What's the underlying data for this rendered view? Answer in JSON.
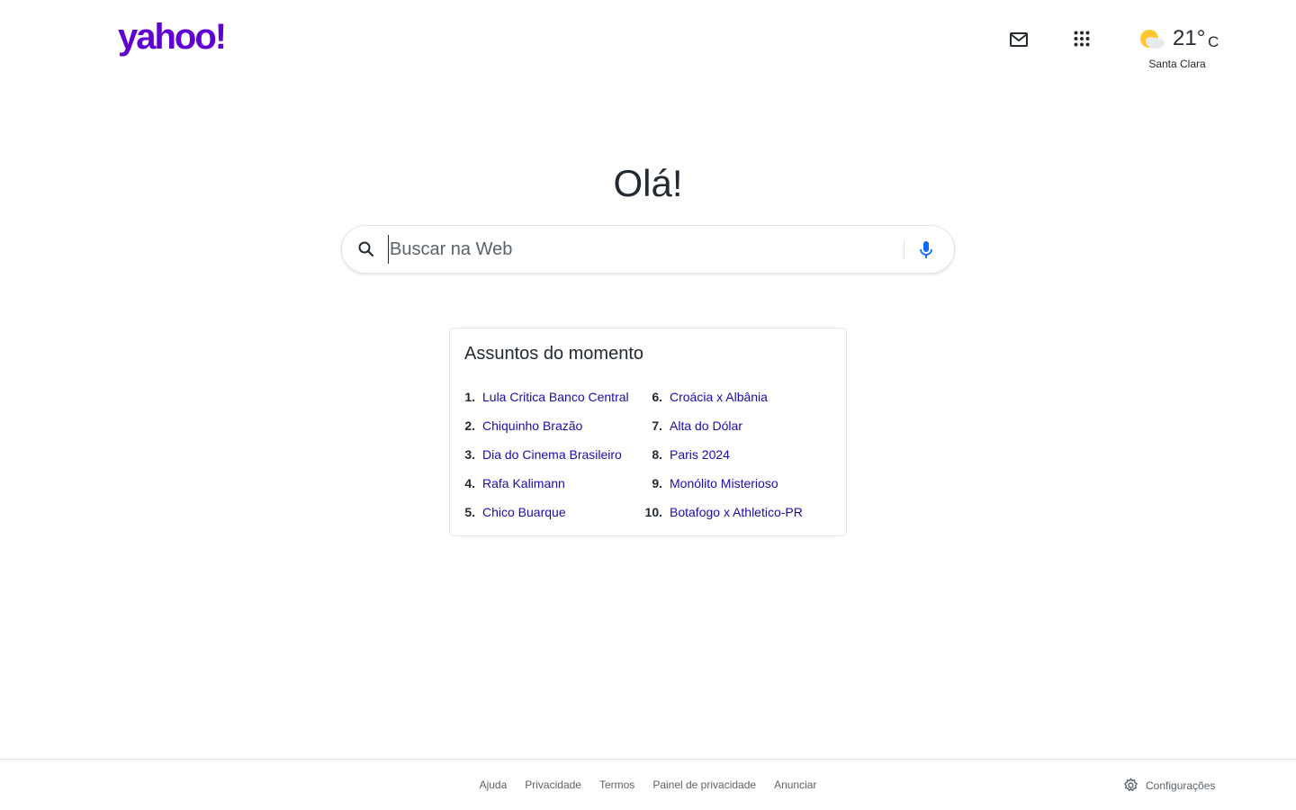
{
  "header": {
    "logo_text": "yahoo!",
    "brand_color": "#6001d2",
    "mail_icon": "mail-icon",
    "apps_icon": "apps-grid-icon",
    "weather": {
      "icon": "partly-cloudy-icon",
      "temperature": "21°",
      "unit": "C",
      "city": "Santa Clara"
    }
  },
  "greeting": "Olá!",
  "search": {
    "placeholder": "Buscar na Web",
    "value": "",
    "search_icon": "search-icon",
    "mic_icon": "microphone-icon",
    "mic_color": "#0f69ff"
  },
  "trending": {
    "title": "Assuntos do momento",
    "link_color": "#1a0dab",
    "items": [
      {
        "rank": "1.",
        "label": "Lula Critica Banco Central"
      },
      {
        "rank": "2.",
        "label": "Chiquinho Brazão"
      },
      {
        "rank": "3.",
        "label": "Dia do Cinema Brasileiro"
      },
      {
        "rank": "4.",
        "label": "Rafa Kalimann"
      },
      {
        "rank": "5.",
        "label": "Chico Buarque"
      },
      {
        "rank": "6.",
        "label": "Croácia x Albânia"
      },
      {
        "rank": "7.",
        "label": "Alta do Dólar"
      },
      {
        "rank": "8.",
        "label": "Paris 2024"
      },
      {
        "rank": "9.",
        "label": "Monólito Misterioso"
      },
      {
        "rank": "10.",
        "label": "Botafogo x Athletico-PR"
      }
    ]
  },
  "footer": {
    "links": [
      "Ajuda",
      "Privacidade",
      "Termos",
      "Painel de privacidade",
      "Anunciar"
    ],
    "settings_label": "Configurações",
    "settings_icon": "gear-icon"
  }
}
